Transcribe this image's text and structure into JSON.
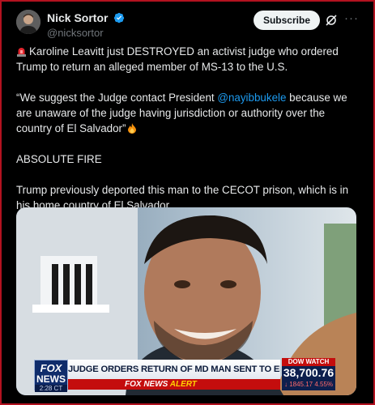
{
  "author": {
    "display_name": "Nick Sortor",
    "handle": "@nicksortor",
    "verified": true
  },
  "actions": {
    "subscribe_label": "Subscribe",
    "grok_icon": "grok-icon",
    "more_icon": "more-options-icon"
  },
  "post": {
    "line1": "Karoline Leavitt just DESTROYED an activist judge who ordered Trump to return an alleged member of MS-13 to the U.S.",
    "quote_before": "“We suggest the Judge contact President ",
    "mention": "@nayibbukele",
    "quote_after": " because we are unaware of the judge having jurisdiction or authority over the country of El Salvador”",
    "line3": "ABSOLUTE FIRE",
    "line4": "Trump previously deported this man to the CECOT prison, which is in his home country of El Salvador."
  },
  "media": {
    "logo_top": "FOX",
    "logo_bottom": "NEWS",
    "clock": "2:28 CT",
    "headline": "JUDGE ORDERS RETURN OF MD MAN SENT TO EL SALVADOR",
    "alert_prefix": "FOX NEWS",
    "alert_word": "ALERT",
    "ticker_label": "DOW WATCH",
    "ticker_value": "38,700.76",
    "ticker_change": "↓ 1845.17 4.55%"
  },
  "colors": {
    "accent": "#1d9bf0",
    "frame_border": "#b3121f",
    "background": "#000000"
  }
}
